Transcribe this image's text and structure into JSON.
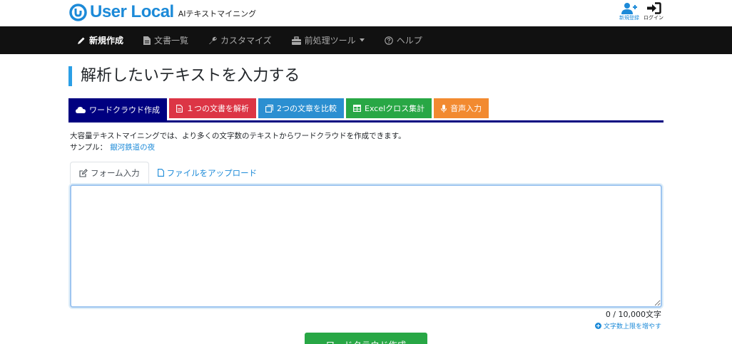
{
  "colors": {
    "brand": "#1c8ad8",
    "navbar_bg": "#111111",
    "tab_wordcloud": "#000080",
    "tab_analyze": "#dc3545",
    "tab_compare": "#2b8fd1",
    "tab_excel": "#28a745",
    "tab_voice": "#f28a30",
    "submit": "#28a745"
  },
  "header": {
    "logo_text": "User Local",
    "logo_sub": "AIテキストマイニング",
    "register_label": "新規登録",
    "login_label": "ログイン"
  },
  "nav": {
    "items": [
      {
        "label": "新規作成",
        "icon": "pencil-icon"
      },
      {
        "label": "文書一覧",
        "icon": "document-icon"
      },
      {
        "label": "カスタマイズ",
        "icon": "wrench-icon"
      },
      {
        "label": "前処理ツール",
        "icon": "toolbox-icon"
      },
      {
        "label": "ヘルプ",
        "icon": "question-circle-icon"
      }
    ]
  },
  "page": {
    "title": "解析したいテキストを入力する"
  },
  "func_tabs": [
    {
      "label": "ワードクラウド作成",
      "icon": "cloud-icon"
    },
    {
      "label": "１つの文書を解析",
      "icon": "file-text-icon"
    },
    {
      "label": "2つの文章を比較",
      "icon": "copy-icon"
    },
    {
      "label": "Excelクロス集計",
      "icon": "table-icon"
    },
    {
      "label": "音声入力",
      "icon": "microphone-icon"
    }
  ],
  "description": {
    "text": "大容量テキストマイニングでは、より多くの文字数のテキストからワードクラウドを作成できます。",
    "sample_label": "サンプル：",
    "sample_link": "銀河鉄道の夜"
  },
  "input_tabs": [
    {
      "label": "フォーム入力",
      "icon": "edit-icon"
    },
    {
      "label": "ファイルをアップロード",
      "icon": "file-icon"
    }
  ],
  "form": {
    "text_value": "",
    "counter": "0 / 10,000文字",
    "increase_link": "文字数上限を増やす",
    "submit_label": "ワードクラウド作成"
  }
}
